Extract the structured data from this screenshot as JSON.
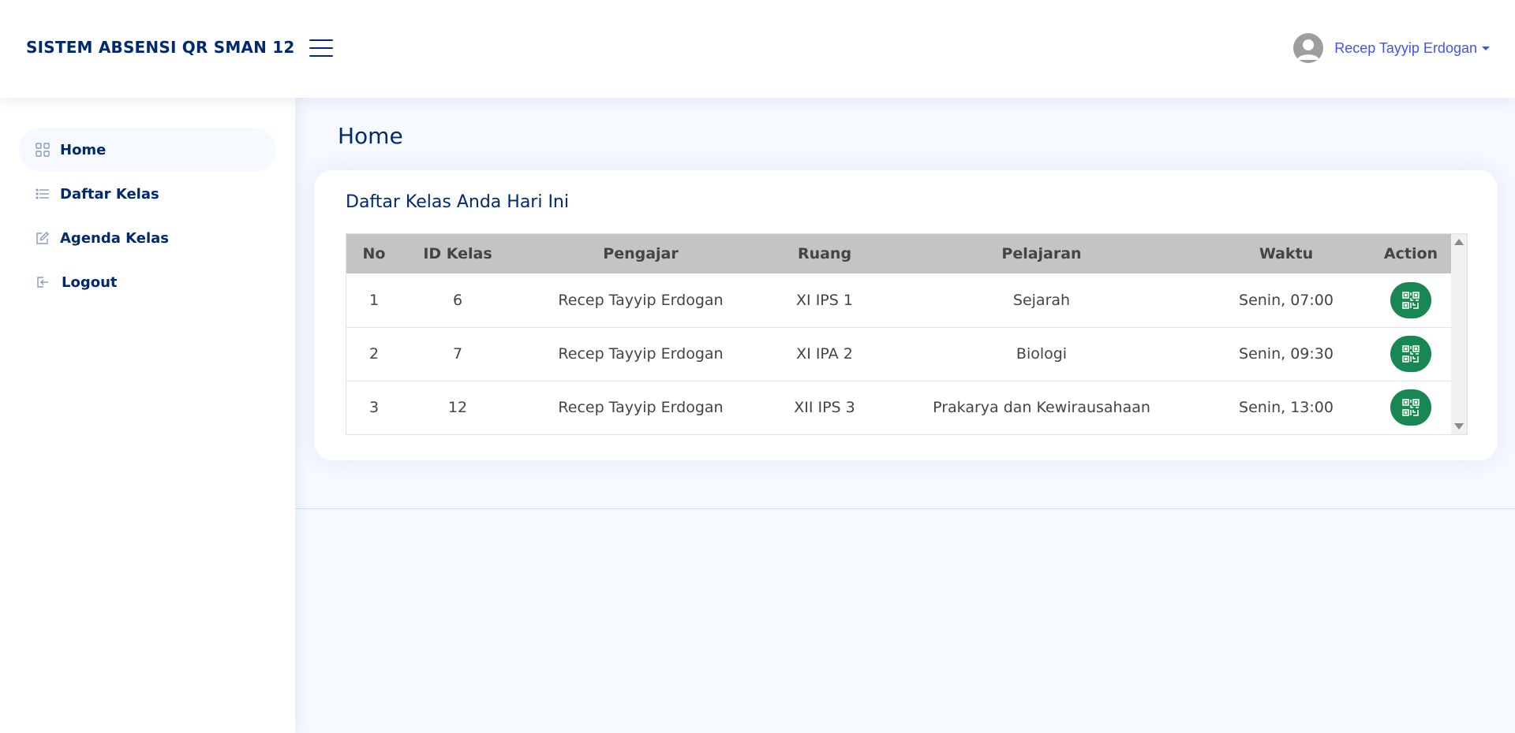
{
  "header": {
    "brand": "SISTEM ABSENSI QR SMAN 12",
    "user_name": "Recep Tayyip Erdogan"
  },
  "sidebar": {
    "items": [
      {
        "label": "Home",
        "icon": "grid-icon",
        "active": true
      },
      {
        "label": "Daftar Kelas",
        "icon": "list-icon",
        "active": false
      },
      {
        "label": "Agenda Kelas",
        "icon": "edit-icon",
        "active": false
      },
      {
        "label": "Logout",
        "icon": "logout-icon",
        "active": false
      }
    ]
  },
  "main": {
    "page_title": "Home",
    "card_title": "Daftar Kelas Anda Hari Ini",
    "table": {
      "headers": [
        "No",
        "ID Kelas",
        "Pengajar",
        "Ruang",
        "Pelajaran",
        "Waktu",
        "Action"
      ],
      "rows": [
        {
          "no": "1",
          "id_kelas": "6",
          "pengajar": "Recep Tayyip Erdogan",
          "ruang": "XI IPS 1",
          "pelajaran": "Sejarah",
          "waktu": "Senin, 07:00"
        },
        {
          "no": "2",
          "id_kelas": "7",
          "pengajar": "Recep Tayyip Erdogan",
          "ruang": "XI IPA 2",
          "pelajaran": "Biologi",
          "waktu": "Senin, 09:30"
        },
        {
          "no": "3",
          "id_kelas": "12",
          "pengajar": "Recep Tayyip Erdogan",
          "ruang": "XII IPS 3",
          "pelajaran": "Prakarya dan Kewirausahaan",
          "waktu": "Senin, 13:00"
        }
      ]
    }
  },
  "colors": {
    "primary": "#012970",
    "accent": "#4154f1",
    "action_button": "#198754",
    "table_header": "#c4c4c4"
  }
}
